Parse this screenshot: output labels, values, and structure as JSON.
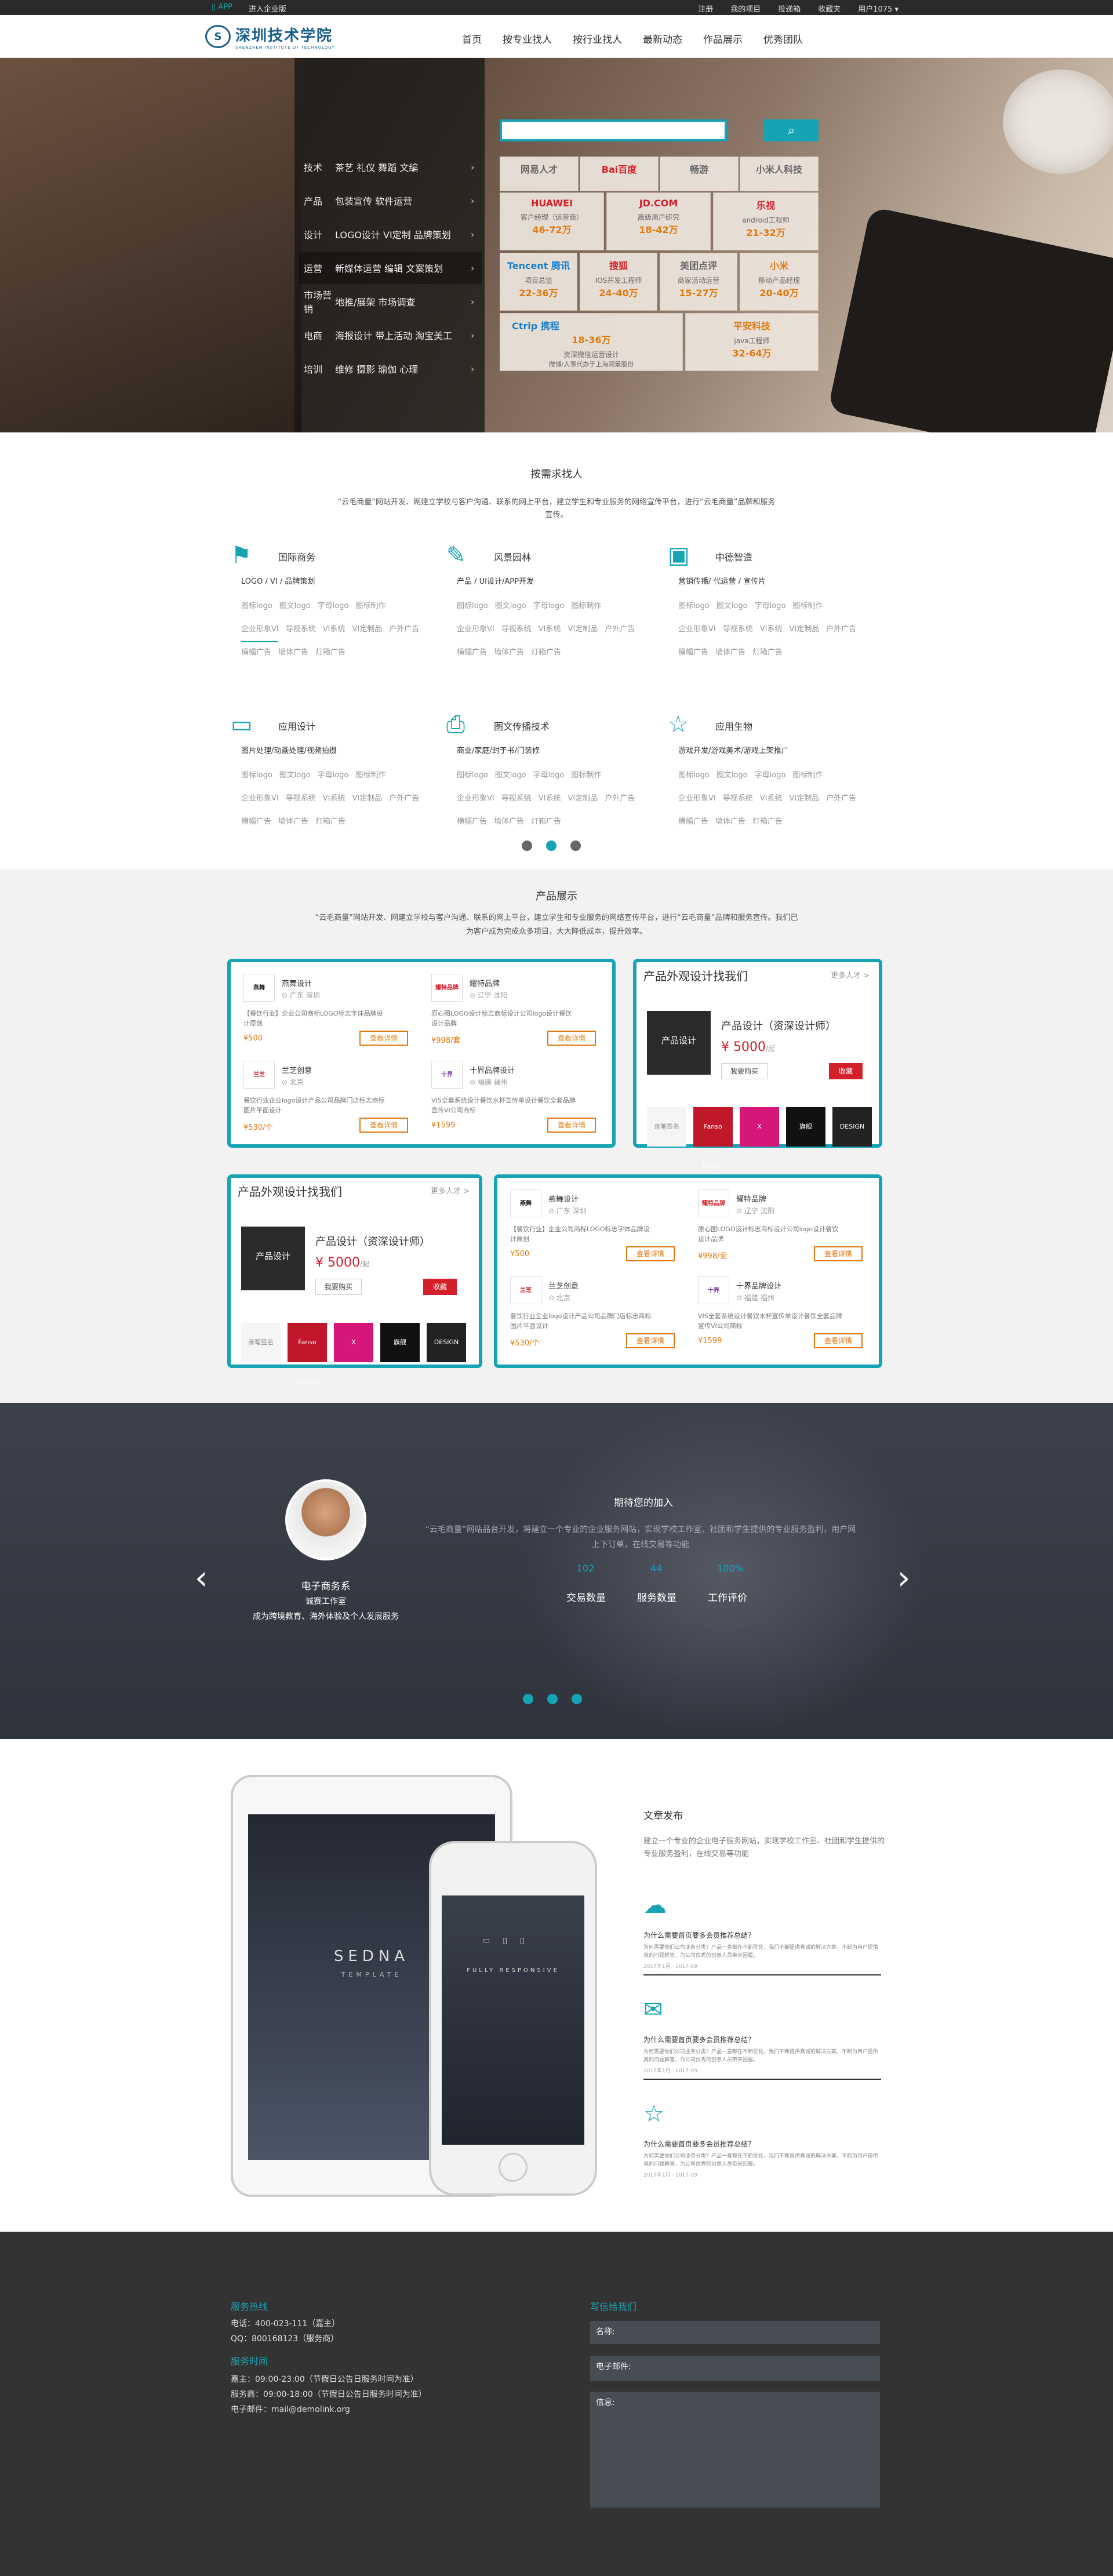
{
  "topbar": {
    "app": "APP",
    "enter": "进入企业版",
    "links": [
      "注册",
      "我的项目",
      "投递箱",
      "收藏夹",
      "用户1075 ▾"
    ]
  },
  "nav": {
    "logo_text": "深圳技术学院",
    "logo_sub": "SHENZHEN INSTITUTE OF TECHNOLOGY",
    "items": [
      "首页",
      "按专业找人",
      "按行业找人",
      "最新动态",
      "作品展示",
      "优秀团队"
    ]
  },
  "hero": {
    "categories": [
      {
        "k": "技术",
        "v": "茶艺 礼仪 舞蹈 文编"
      },
      {
        "k": "产品",
        "v": "包装宣传 软件运营"
      },
      {
        "k": "设计",
        "v": "LOGO设计 VI定制 品牌策划"
      },
      {
        "k": "运营",
        "v": "新媒体运营 编辑 文案策划"
      },
      {
        "k": "市场营销",
        "v": "地推/展架 市场调查"
      },
      {
        "k": "电商",
        "v": "海报设计 带上活动 淘宝美工"
      },
      {
        "k": "培训",
        "v": "维修 摄影 瑜伽 心理"
      }
    ],
    "brands_row1": [
      "网易人才",
      "Bai百度",
      "畅游",
      "小米人科技"
    ],
    "brands": [
      {
        "name": "HUAWEI",
        "job": "客户经理（运营商）",
        "salary": "46-72万"
      },
      {
        "name": "JD.COM",
        "job": "高级用户研究",
        "salary": "18-42万"
      },
      {
        "name": "乐视",
        "job": "android工程师",
        "salary": "21-32万"
      },
      {
        "name": "Tencent 腾讯",
        "job": "项目总监",
        "salary": "22-36万"
      },
      {
        "name": "搜狐",
        "job": "IOS开发工程师",
        "salary": "24-40万"
      },
      {
        "name": "美团点评",
        "job": "商家活动运营",
        "salary": "15-27万"
      },
      {
        "name": "小米",
        "job": "移动产品经理",
        "salary": "20-40万"
      },
      {
        "name": "Ctrip 携程",
        "job": "资深微信运营设计",
        "salary": "18-36万",
        "extra": "微博/人事代办于上海润景股份"
      },
      {
        "name": "平安科技",
        "job": "java工程师",
        "salary": "32-64万"
      }
    ]
  },
  "services": {
    "title": "按需求找人",
    "desc": "“云毛商量”网站开发、网建立学校与客户沟通、联系的网上平台，建立学生和专业服务的网络宣传平台，进行“云毛商量”品牌和服务宣传。",
    "items": [
      {
        "name": "国际商务",
        "sub": "LOGO / VI / 品牌策划",
        "tags": [
          "图标logo",
          "图文logo",
          "字母logo",
          "图标制作",
          "企业形象VI",
          "导视系统",
          "VI系统",
          "VI定制品",
          "户外广告",
          "横幅广告",
          "墙体广告",
          "灯箱广告"
        ]
      },
      {
        "name": "风景园林",
        "sub": "产品 / UI设计/APP开发",
        "tags": [
          "图标logo",
          "图文logo",
          "字母logo",
          "图标制作",
          "企业形象VI",
          "导视系统",
          "VI系统",
          "VI定制品",
          "户外广告",
          "横幅广告",
          "墙体广告",
          "灯箱广告"
        ]
      },
      {
        "name": "中德智造",
        "sub": "营销传播/ 代运营 / 宣传片",
        "tags": [
          "图标logo",
          "图文logo",
          "字母logo",
          "图标制作",
          "企业形象VI",
          "导视系统",
          "VI系统",
          "VI定制品",
          "户外广告",
          "横幅广告",
          "墙体广告",
          "灯箱广告"
        ]
      },
      {
        "name": "应用设计",
        "sub": "图片处理/动画处理/视频拍摄",
        "tags": [
          "图标logo",
          "图文logo",
          "字母logo",
          "图标制作",
          "企业形象VI",
          "导视系统",
          "VI系统",
          "VI定制品",
          "户外广告",
          "横幅广告",
          "墙体广告",
          "灯箱广告"
        ]
      },
      {
        "name": "图文传播技术",
        "sub": "商业/家庭/封于书/门装修",
        "tags": [
          "图标logo",
          "图文logo",
          "字母logo",
          "图标制作",
          "企业形象VI",
          "导视系统",
          "VI系统",
          "VI定制品",
          "户外广告",
          "横幅广告",
          "墙体广告",
          "灯箱广告"
        ]
      },
      {
        "name": "应用生物",
        "sub": "游戏开发/游戏美术/游戏上架推广",
        "tags": [
          "图标logo",
          "图文logo",
          "字母logo",
          "图标制作",
          "企业形象VI",
          "导视系统",
          "VI系统",
          "VI定制品",
          "户外广告",
          "横幅广告",
          "墙体广告",
          "灯箱广告"
        ]
      }
    ]
  },
  "products": {
    "title": "产品展示",
    "desc": "“云毛商量”网站开发、网建立学校与客户沟通、联系的网上平台，建立学生和专业服务的网络宣传平台，进行“云毛商量”品牌和服务宣传。我们已为客户成为完成众多项目，大大降低成本，提升效率。",
    "cards": [
      {
        "logo": "燕舞",
        "name": "燕舞设计",
        "loc": "广东 深圳",
        "desc": "【餐饮行业】企业公司商标LOGO标志字体品牌设计原创",
        "price": "¥500",
        "btn": "查看详情"
      },
      {
        "logo": "耀特品牌",
        "name": "耀特品牌",
        "loc": "辽宁 沈阳",
        "desc": "原心图LOGO设计标志商标设计公司logo设计餐饮设计品牌",
        "price": "¥998/套",
        "btn": "查看详情"
      },
      {
        "logo": "兰芝",
        "name": "兰芝创意",
        "loc": "北京",
        "desc": "餐饮行业企业logo设计产品公司品牌门店标志商标图片平面设计",
        "price": "¥530/个",
        "btn": "查看详情"
      },
      {
        "logo": "十界",
        "name": "十界品牌设计",
        "loc": "福建 福州",
        "desc": "VIS全套系统设计餐饮水杯宣传单设计餐饮全套品牌宣传VI公司商标",
        "price": "¥1599",
        "btn": "查看详情"
      }
    ],
    "feature": {
      "title": "产品外观设计找我们",
      "more": "更多人才 >",
      "img": "产品设计",
      "name": "产品设计（资深设计师）",
      "price": "¥ 5000",
      "unit": "/起",
      "btn": "我要购买",
      "fav": "收藏",
      "thumbs": [
        "亲笔签名",
        "Fanso Design",
        "X",
        "旗舰",
        "DESIGN"
      ]
    }
  },
  "team": {
    "member_name": "电子商务系",
    "member_role": "诚赛工作室",
    "member_desc": "成为跨境教育、海外体验及个人发展服务",
    "title": "期待您的加入",
    "desc": "“云毛商量”网站品台开发，将建立一个专业的企业服务网站，实现学校工作室、社团和学生提供的专业服务盈利，用户网上下订单，在线交易等功能",
    "stats": [
      {
        "num": "102",
        "label": "交易数量"
      },
      {
        "num": "44",
        "label": "服务数量"
      },
      {
        "num": "100%",
        "label": "工作评价"
      }
    ]
  },
  "article": {
    "ipad_brand": "SEDNA",
    "ipad_sub": "TEMPLATE",
    "iphone_text": "FULLY RESPONSIVE",
    "title": "文章发布",
    "desc": "建立一个专业的企业电子服务网站，实现学校工作室、社团和学生提供的专业服务盈利，在线交易等功能",
    "items": [
      {
        "q": "为什么需要首页要多会员推荐总结？",
        "a": "为何需要你们公司业务分类？产品一直都在不断优化，我们不断提供真诚的解决方案，不断为用户提供真的问题解答，为公司优秀的创意人员带来回报。",
        "date": "2017年1月 · 2017-09"
      },
      {
        "q": "为什么需要首页要多会员推荐总结？",
        "a": "为何需要你们公司业务分类？产品一直都在不断优化，我们不断提供真诚的解决方案，不断为用户提供真的问题解答，为公司优秀的创意人员带来回报。",
        "date": "2017年1月 · 2017-09"
      },
      {
        "q": "为什么需要首页要多会员推荐总结？",
        "a": "为何需要你们公司业务分类？产品一直都在不断优化，我们不断提供真诚的解决方案，不断为用户提供真的问题解答，为公司优秀的创意人员带来回报。",
        "date": "2017年1月 · 2017-09"
      }
    ]
  },
  "footer": {
    "hotline_title": "服务热线",
    "phone": "电话：400-023-111（嘉主）",
    "qq": "QQ：800168123（服务商）",
    "hours_title": "服务时间",
    "hours1": "嘉主：09:00-23:00（节假日公告日服务时间为准）",
    "hours2": "服务商：09:00-18:00（节假日公告日服务时间为准）",
    "email": "电子邮件：mail@demolink.org",
    "contact_title": "写信给我们",
    "name_ph": "名称:",
    "email_ph": "电子邮件:",
    "msg_ph": "信息:"
  },
  "colors": {
    "accent": "#16a3b3",
    "orange": "#e07a10",
    "red": "#d4202a",
    "dark": "#333333"
  }
}
